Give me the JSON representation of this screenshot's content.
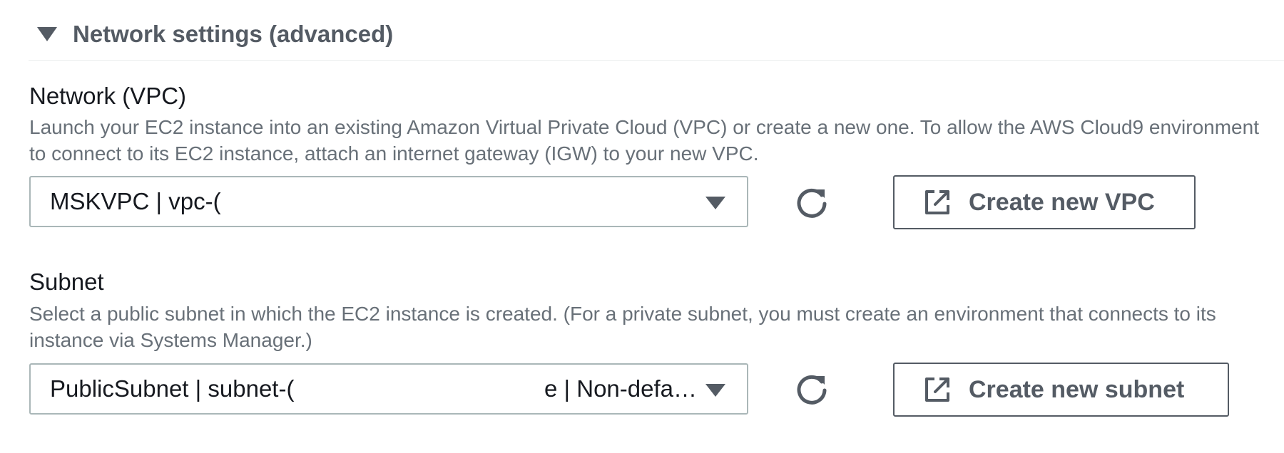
{
  "section": {
    "title": "Network settings (advanced)",
    "expanded": true,
    "icon": "caret-down-icon"
  },
  "vpc": {
    "label": "Network (VPC)",
    "description": "Launch your EC2 instance into an existing Amazon Virtual Private Cloud (VPC) or create a new one. To allow the AWS Cloud9 environment to connect to its EC2 instance, attach an internet gateway (IGW) to your new VPC.",
    "selected_value": "MSKVPC | vpc-(",
    "refresh_icon": "refresh-icon",
    "create_button_label": "Create new VPC",
    "create_button_icon": "external-link-icon"
  },
  "subnet": {
    "label": "Subnet",
    "description": "Select a public subnet in which the EC2 instance is created. (For a private subnet, you must create an environment that connects to its instance via Systems Manager.)",
    "selected_value_start": "PublicSubnet | subnet-(",
    "selected_value_end": "e | Non-defa…",
    "refresh_icon": "refresh-icon",
    "create_button_label": "Create new subnet",
    "create_button_icon": "external-link-icon"
  },
  "colors": {
    "text": "#16191f",
    "secondary_text": "#687078",
    "header_text": "#545b64",
    "border": "#aab7b8"
  }
}
